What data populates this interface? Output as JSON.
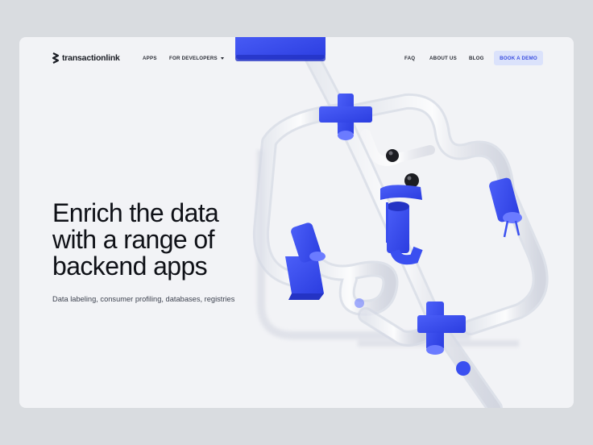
{
  "brand": {
    "name": "transactionlink"
  },
  "nav": {
    "apps": "APPS",
    "for_developers": "FOR DEVELOPERS",
    "faq": "FAQ",
    "about_us": "ABOUT US",
    "blog": "BLOG",
    "book_demo": "BOOK A DEMO"
  },
  "hero": {
    "title_line1": "Enrich the data",
    "title_line2": "with a range of",
    "title_line3": "backend apps",
    "subtitle": "Data labeling, consumer profiling, databases, registries"
  },
  "colors": {
    "accent": "#3b4fe0",
    "cta_bg": "#dbe2fb",
    "page_bg": "#d9dce0",
    "card_bg": "#f2f3f6",
    "illustration_blue": "#3a4ff0"
  },
  "icons": {
    "logo": "transactionlink-logo-icon",
    "dropdown": "chevron-down-icon"
  }
}
